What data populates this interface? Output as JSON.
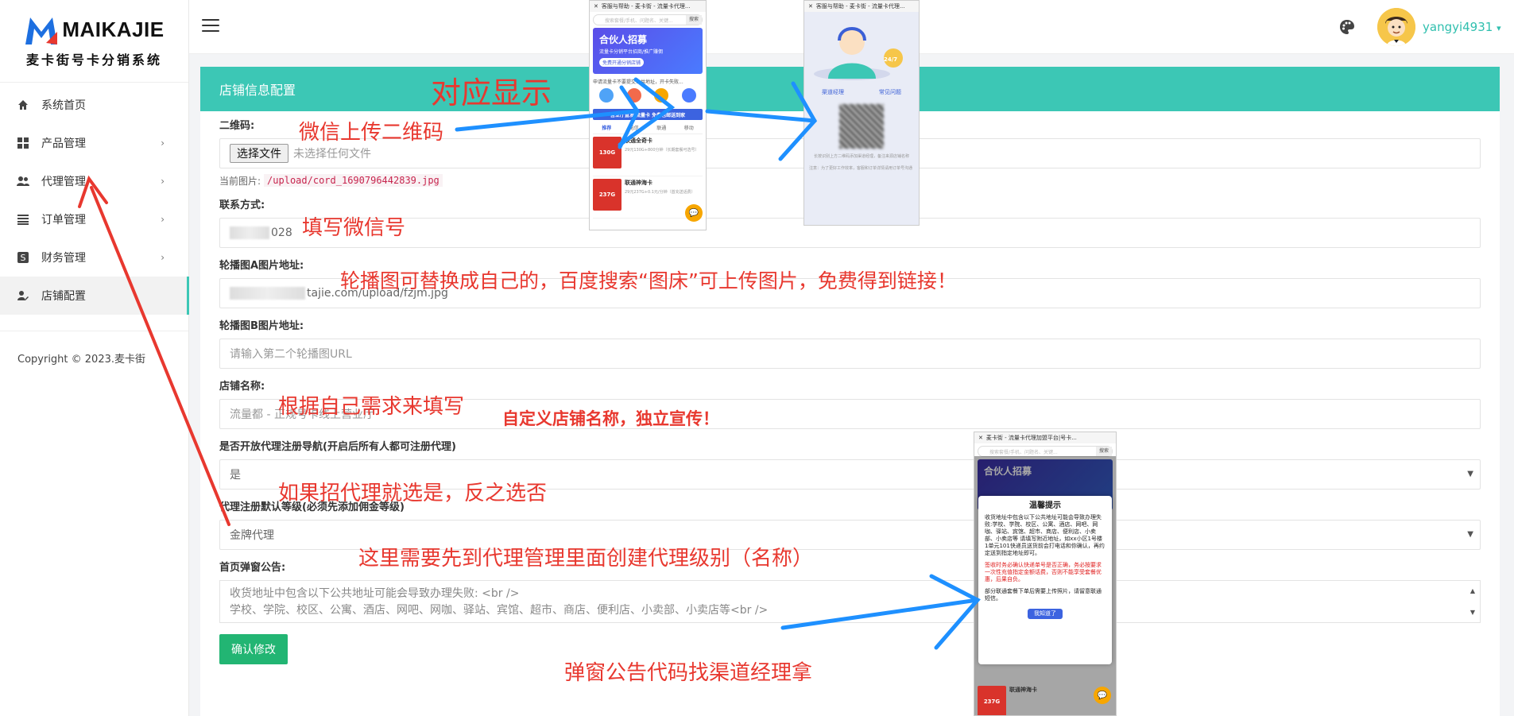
{
  "logo": {
    "name": "MAIKAJIE",
    "subtitle": "麦卡街号卡分销系统"
  },
  "sidebar": {
    "items": [
      {
        "label": "系统首页",
        "icon": "home-icon",
        "has_submenu": false
      },
      {
        "label": "产品管理",
        "icon": "grid-icon",
        "has_submenu": true
      },
      {
        "label": "代理管理",
        "icon": "users-icon",
        "has_submenu": true
      },
      {
        "label": "订单管理",
        "icon": "list-icon",
        "has_submenu": true
      },
      {
        "label": "财务管理",
        "icon": "dollar-icon",
        "has_submenu": true
      },
      {
        "label": "店铺配置",
        "icon": "user-edit-icon",
        "has_submenu": false,
        "active": true
      }
    ],
    "copyright": "Copyright © 2023.麦卡街"
  },
  "header": {
    "username": "yangyi4931",
    "username_caret": "▾"
  },
  "panel": {
    "title": "店铺信息配置",
    "fields": {
      "qrcode_label": "二维码:",
      "file_button": "选择文件",
      "file_status": "未选择任何文件",
      "current_image_label": "当前图片:",
      "current_image_path": "/upload/cord_1690796442839.jpg",
      "contact_label": "联系方式:",
      "contact_value": "028",
      "banner_a_label": "轮播图A图片地址:",
      "banner_a_value": "tajie.com/upload/fzjm.jpg",
      "banner_b_label": "轮播图B图片地址:",
      "banner_b_placeholder": "请输入第二个轮播图URL",
      "shop_name_label": "店铺名称:",
      "shop_name_placeholder": "流量都 - 正规号卡线上营业厅",
      "open_reg_label": "是否开放代理注册导航(开启后所有人都可注册代理)",
      "open_reg_value": "是",
      "default_level_label": "代理注册默认等级(必须先添加佣金等级)",
      "default_level_value": "金牌代理",
      "popup_label": "首页弹窗公告:",
      "popup_line1": "收货地址中包含以下公共地址可能会导致办理失败: <br />",
      "popup_line2": "学校、学院、校区、公寓、酒店、网吧、网咖、驿站、宾馆、超市、商店、便利店、小卖部、小卖店等<br />",
      "submit": "确认修改"
    }
  },
  "annotations": {
    "a1": "对应显示",
    "a2": "微信上传二维码",
    "a3": "填写微信号",
    "a4": "轮播图可替换成自己的，百度搜索“图床”可上传图片，免费得到链接！",
    "a5": "根据自己需求来填写",
    "a6": "自定义店铺名称，独立宣传！",
    "a7": "如果招代理就选是，反之选否",
    "a8": "这里需要先到代理管理里面创建代理级别（名称）",
    "a9": "弹窗公告代码找渠道经理拿",
    "arrow_color": "#1e90ff",
    "arrow_red": "#e8382f"
  },
  "phone1": {
    "title": "客服与帮助 - 麦卡街 - 流量卡代理...",
    "search_placeholder": "搜索套餐/手机、问题名、关键...",
    "search_btn": "搜索",
    "banner_title": "合伙人招募",
    "banner_sub": "流量卡分销平台招商/推广赚佣",
    "banner_btn": "免费开通分销店铺",
    "notice": "申请流量卡不要提交公共地址，开卡失败...",
    "strip": "营业厅直发 流量卡 免费包邮送到家",
    "tabs": [
      "推荐",
      "电信",
      "联通",
      "移动"
    ],
    "card1_title": "联通全奇卡",
    "card1_thumb": "130G",
    "card1_sub": "29元130G+800分钟（长期套餐可选号）",
    "card2_title": "联通神海卡",
    "card2_thumb": "237G",
    "card2_sub": "29元237G+0.1元/分钟（首充送话费）"
  },
  "phone2": {
    "title": "客服与帮助 - 麦卡街 - 流量卡代理...",
    "badge": "24/7",
    "tab_a": "渠道经理",
    "tab_b": "常见问题",
    "note": "长按识别上方二维码添加渠道经理，备注来源店铺名称",
    "note2": "注意：为了更好工作效率，客服和订单详情请用订单号沟通"
  },
  "phone3": {
    "title": "麦卡街 - 流量卡代理加盟平台|号卡...",
    "search_placeholder": "搜索套餐/手机、问题名、关键...",
    "search_btn": "搜索",
    "banner_title": "合伙人招募",
    "modal_title": "温馨提示",
    "modal_body": "收货地址中包含以下公共地址可能会导致办理失败:学校、学院、校区、公寓、酒店、网吧、网咖、驿站、宾馆、超市、商店、便利店、小卖部、小卖店等 请填写附近地址，如xx小区1号楼1单元101快递员送货前会打电话和你确认，再约定送到指定地址即可。",
    "modal_red": "签收时务必确认快递单号是否正确，务必按要求一次性充值指定金额话费，否则不能享受套餐优惠，后果自负。",
    "modal_tail": "部分联通套餐下单后需要上传照片，请留意联通短信。",
    "modal_btn": "我知道了",
    "card_title": "联通神海卡",
    "card_thumb": "237G"
  }
}
